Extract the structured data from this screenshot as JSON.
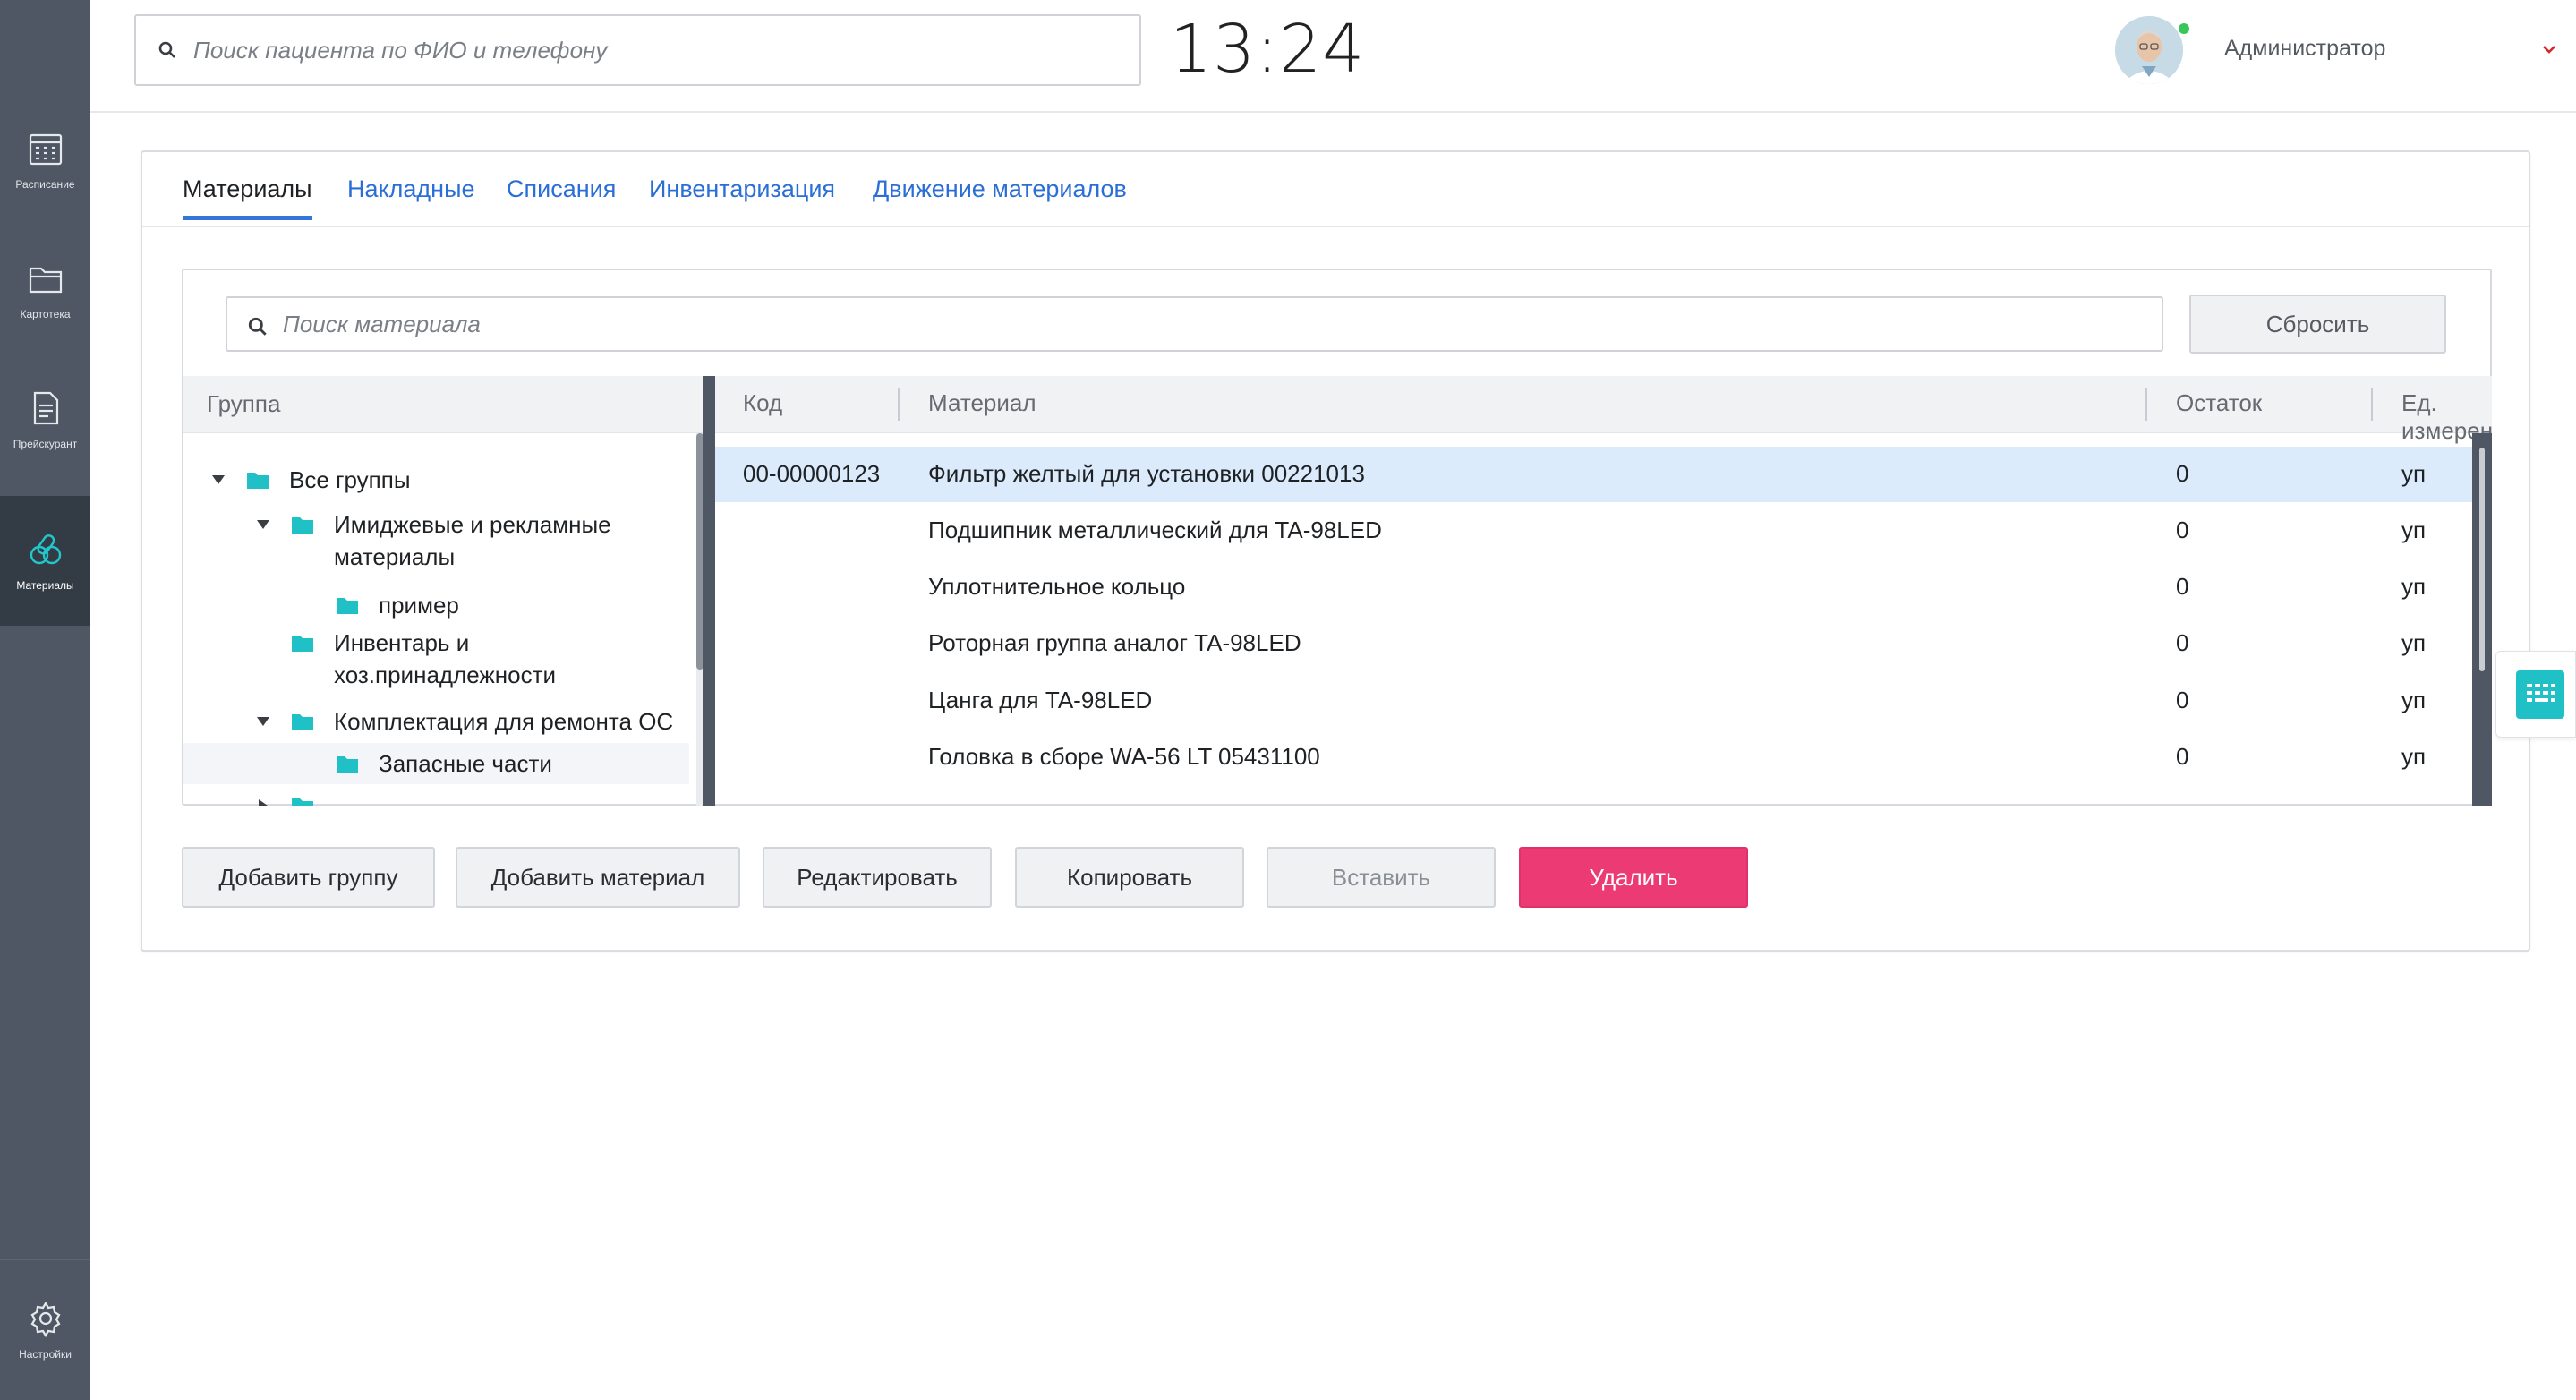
{
  "sidebar": {
    "items": [
      {
        "label": "Расписание",
        "icon": "calendar-icon"
      },
      {
        "label": "Картотека",
        "icon": "folder-open-icon"
      },
      {
        "label": "Прейскурант",
        "icon": "document-icon"
      },
      {
        "label": "Материалы",
        "icon": "pills-icon",
        "active": true
      }
    ],
    "settings": {
      "label": "Настройки",
      "icon": "gear-icon"
    }
  },
  "header": {
    "search_placeholder": "Поиск пациента по ФИО и телефону",
    "time": "13:24",
    "user_name": "Администратор",
    "online_color": "#3ac55a"
  },
  "tabs": [
    {
      "label": "Материалы",
      "active": true
    },
    {
      "label": "Накладные"
    },
    {
      "label": "Списания"
    },
    {
      "label": "Инвентаризация"
    },
    {
      "label": "Движение материалов"
    }
  ],
  "materials": {
    "search_placeholder": "Поиск материала",
    "reset_label": "Сбросить",
    "group_header": "Группа",
    "tree": [
      {
        "label": "Все группы",
        "expanded": true
      },
      {
        "label": "Имиджевые и рекламные материалы",
        "expanded": true
      },
      {
        "label": "пример"
      },
      {
        "label": "Инвентарь и хоз.принадлежности"
      },
      {
        "label": "Комплектация для ремонта ОС",
        "expanded": true
      },
      {
        "label": "Запасные части",
        "selected": true
      }
    ],
    "columns": {
      "code": "Код",
      "material": "Материал",
      "stock": "Остаток",
      "unit": "Ед. измерения"
    },
    "rows": [
      {
        "code": "00-00000123",
        "material": "Фильтр желтый для установки 00221013",
        "stock": "0",
        "unit": "уп",
        "selected": true
      },
      {
        "code": "",
        "material": "Подшипник металлический для TA-98LED",
        "stock": "0",
        "unit": "уп"
      },
      {
        "code": "",
        "material": "Уплотнительное кольцо",
        "stock": "0",
        "unit": "уп"
      },
      {
        "code": "",
        "material": "Роторная группа аналог TA-98LED",
        "stock": "0",
        "unit": "уп"
      },
      {
        "code": "",
        "material": "Цанга для TA-98LED",
        "stock": "0",
        "unit": "уп"
      },
      {
        "code": "",
        "material": "Головка в сборе WA-56 LT 05431100",
        "stock": "0",
        "unit": "уп"
      }
    ]
  },
  "actions": {
    "add_group": "Добавить группу",
    "add_material": "Добавить материал",
    "edit": "Редактировать",
    "copy": "Копировать",
    "paste": "Вставить",
    "delete": "Удалить"
  },
  "colors": {
    "accent": "#3574d8",
    "sidebar": "#4e5763",
    "danger": "#ec3a74",
    "folder": "#1fc1c6",
    "selected_row": "#dcebfb"
  }
}
